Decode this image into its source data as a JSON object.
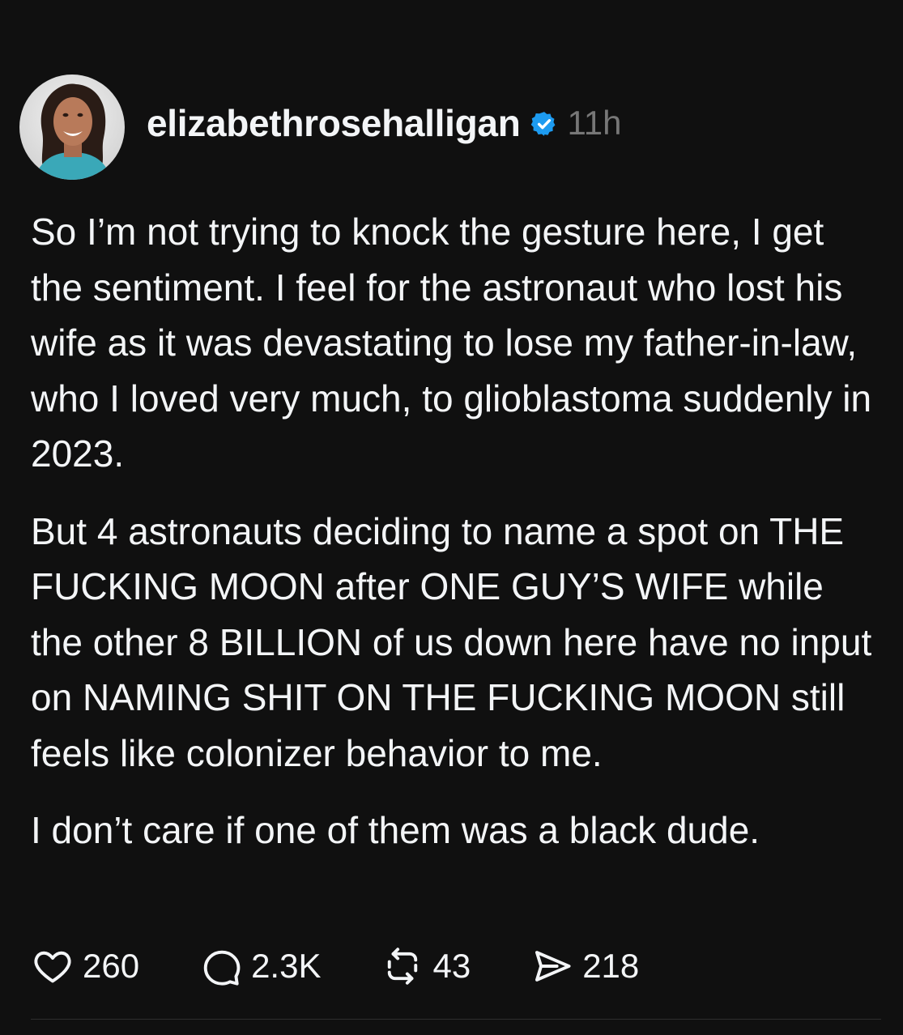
{
  "post": {
    "username": "elizabethrosehalligan",
    "timestamp": "11h",
    "verified_icon": "verified-badge-icon",
    "colors": {
      "background": "#101010",
      "text": "#f3f5f7",
      "muted": "#777777",
      "verified": "#1d9bf0"
    },
    "paragraphs": [
      "So I’m not trying to knock the gesture here, I get the sentiment. I feel for the astronaut who lost his wife as it was devastating to lose my father-in-law, who I loved very much, to glioblastoma suddenly in 2023.",
      "But 4 astronauts deciding to name a spot on THE FUCKING MOON after ONE GUY’S WIFE while the other 8 BILLION of us down here have no input on NAMING SHIT ON THE FUCKING MOON still feels like colonizer behavior to me.",
      "I don’t care if one of them was a black dude."
    ],
    "actions": {
      "like": {
        "icon": "heart-icon",
        "count": "260"
      },
      "reply": {
        "icon": "speech-bubble-icon",
        "count": "2.3K"
      },
      "repost": {
        "icon": "repost-icon",
        "count": "43"
      },
      "share": {
        "icon": "send-icon",
        "count": "218"
      }
    }
  }
}
